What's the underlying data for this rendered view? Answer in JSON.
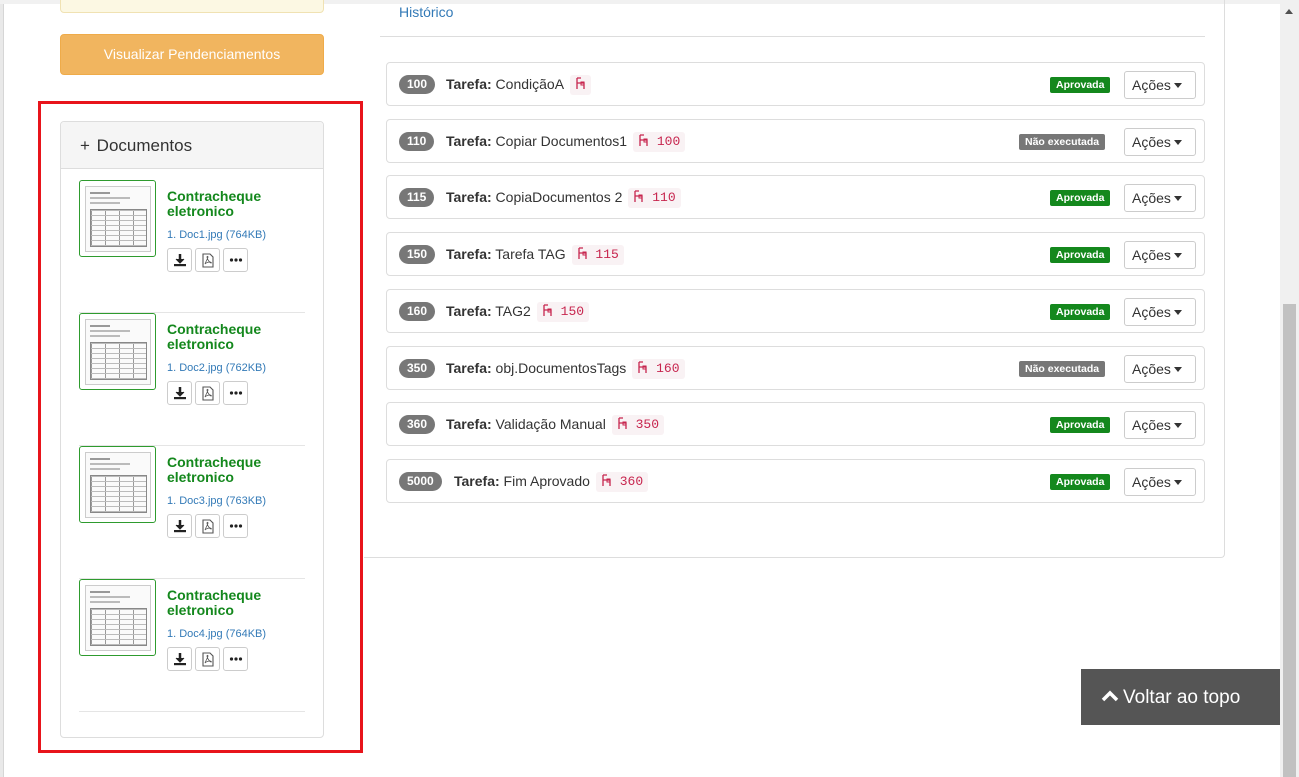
{
  "left": {
    "visualizar_button": "Visualizar Pendenciamentos",
    "docs_panel": {
      "plus": "+",
      "title": "Documentos",
      "items": [
        {
          "title": "Contracheque eletronico",
          "file": "1. Doc1.jpg (764KB)"
        },
        {
          "title": "Contracheque eletronico",
          "file": "1. Doc2.jpg (762KB)"
        },
        {
          "title": "Contracheque eletronico",
          "file": "1. Doc3.jpg (763KB)"
        },
        {
          "title": "Contracheque eletronico",
          "file": "1. Doc4.jpg (764KB)"
        }
      ],
      "item_icons": [
        "download-icon",
        "pdf-icon",
        "more-icon"
      ]
    }
  },
  "main": {
    "historico_link": "Histórico",
    "task_prefix": "Tarefa:",
    "actions_label": "Ações",
    "tasks": [
      {
        "num": "100",
        "name": "CondiçãoA",
        "dep": "",
        "status": "Aprovada",
        "status_type": "ok"
      },
      {
        "num": "110",
        "name": "Copiar Documentos1",
        "dep": "100",
        "status": "Não executada",
        "status_type": "no"
      },
      {
        "num": "115",
        "name": "CopiaDocumentos 2",
        "dep": "110",
        "status": "Aprovada",
        "status_type": "ok"
      },
      {
        "num": "150",
        "name": "Tarefa TAG",
        "dep": "115",
        "status": "Aprovada",
        "status_type": "ok"
      },
      {
        "num": "160",
        "name": "TAG2",
        "dep": "150",
        "status": "Aprovada",
        "status_type": "ok"
      },
      {
        "num": "350",
        "name": "obj.DocumentosTags",
        "dep": "160",
        "status": "Não executada",
        "status_type": "no"
      },
      {
        "num": "360",
        "name": "Validação Manual",
        "dep": "350",
        "status": "Aprovada",
        "status_type": "ok"
      },
      {
        "num": "5000",
        "name": "Fim Aprovado",
        "dep": "360",
        "status": "Aprovada",
        "status_type": "ok"
      }
    ]
  },
  "back_to_top": "Voltar ao topo",
  "colors": {
    "approved": "#14881d",
    "not_executed": "#777777",
    "highlight": "#e8141b",
    "warning_button": "#f0ad4e"
  }
}
